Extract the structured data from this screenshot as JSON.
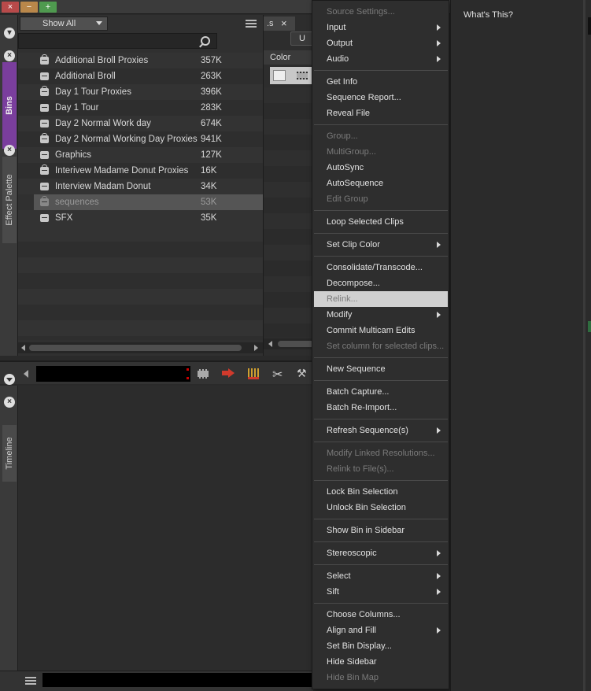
{
  "window": {
    "close": "×",
    "minimize": "−",
    "maximize": "+"
  },
  "bins_panel": {
    "filter": "Show All",
    "tabs": {
      "bins": "Bins",
      "effect_palette": "Effect Palette"
    },
    "items": [
      {
        "name": "Additional Broll Proxies",
        "size": "357K",
        "locked": true
      },
      {
        "name": "Additional Broll",
        "size": "263K",
        "locked": false
      },
      {
        "name": "Day 1 Tour Proxies",
        "size": "396K",
        "locked": true
      },
      {
        "name": "Day 1 Tour",
        "size": "283K",
        "locked": false
      },
      {
        "name": "Day 2 Normal Work day",
        "size": "674K",
        "locked": false
      },
      {
        "name": "Day 2 Normal Working Day Proxies",
        "size": "941K",
        "locked": true
      },
      {
        "name": "Graphics",
        "size": "127K",
        "locked": false
      },
      {
        "name": "Interivew Madame Donut Proxies",
        "size": "16K",
        "locked": true
      },
      {
        "name": "Interview Madam Donut",
        "size": "34K",
        "locked": false
      },
      {
        "name": "sequences",
        "size": "53K",
        "locked": true,
        "selected": true
      },
      {
        "name": "SFX",
        "size": "35K",
        "locked": false
      }
    ]
  },
  "mid_panel": {
    "tab_label": ".s",
    "close": "×",
    "button": "U",
    "column_header": "Color"
  },
  "timeline": {
    "tab": "Timeline"
  },
  "context_menu": {
    "items": [
      {
        "label": "Source Settings...",
        "disabled": true,
        "submenu": false
      },
      {
        "label": "Input",
        "disabled": false,
        "submenu": true
      },
      {
        "label": "Output",
        "disabled": false,
        "submenu": true
      },
      {
        "label": "Audio",
        "disabled": false,
        "submenu": true
      },
      {
        "separator": true
      },
      {
        "label": "Get Info",
        "disabled": false,
        "submenu": false
      },
      {
        "label": "Sequence Report...",
        "disabled": false,
        "submenu": false
      },
      {
        "label": "Reveal File",
        "disabled": false,
        "submenu": false
      },
      {
        "separator": true
      },
      {
        "label": "Group...",
        "disabled": true,
        "submenu": false
      },
      {
        "label": "MultiGroup...",
        "disabled": true,
        "submenu": false
      },
      {
        "label": "AutoSync",
        "disabled": false,
        "submenu": false
      },
      {
        "label": "AutoSequence",
        "disabled": false,
        "submenu": false
      },
      {
        "label": "Edit Group",
        "disabled": true,
        "submenu": false
      },
      {
        "separator": true
      },
      {
        "label": "Loop Selected Clips",
        "disabled": false,
        "submenu": false
      },
      {
        "separator": true
      },
      {
        "label": "Set Clip Color",
        "disabled": false,
        "submenu": true
      },
      {
        "separator": true
      },
      {
        "label": "Consolidate/Transcode...",
        "disabled": false,
        "submenu": false
      },
      {
        "label": "Decompose...",
        "disabled": false,
        "submenu": false
      },
      {
        "label": "Relink...",
        "disabled": false,
        "submenu": false,
        "highlighted": true
      },
      {
        "label": "Modify",
        "disabled": false,
        "submenu": true
      },
      {
        "label": "Commit Multicam Edits",
        "disabled": false,
        "submenu": false
      },
      {
        "label": "Set column for selected clips...",
        "disabled": true,
        "submenu": false
      },
      {
        "separator": true
      },
      {
        "label": "New Sequence",
        "disabled": false,
        "submenu": false
      },
      {
        "separator": true
      },
      {
        "label": "Batch Capture...",
        "disabled": false,
        "submenu": false
      },
      {
        "label": "Batch Re-Import...",
        "disabled": false,
        "submenu": false
      },
      {
        "separator": true
      },
      {
        "label": "Refresh Sequence(s)",
        "disabled": false,
        "submenu": true
      },
      {
        "separator": true
      },
      {
        "label": "Modify Linked Resolutions...",
        "disabled": true,
        "submenu": false
      },
      {
        "label": "Relink to File(s)...",
        "disabled": true,
        "submenu": false
      },
      {
        "separator": true
      },
      {
        "label": "Lock Bin Selection",
        "disabled": false,
        "submenu": false
      },
      {
        "label": "Unlock Bin Selection",
        "disabled": false,
        "submenu": false
      },
      {
        "separator": true
      },
      {
        "label": "Show Bin in Sidebar",
        "disabled": false,
        "submenu": false
      },
      {
        "separator": true
      },
      {
        "label": "Stereoscopic",
        "disabled": false,
        "submenu": true
      },
      {
        "separator": true
      },
      {
        "label": "Select",
        "disabled": false,
        "submenu": true
      },
      {
        "label": "Sift",
        "disabled": false,
        "submenu": true
      },
      {
        "separator": true
      },
      {
        "label": "Choose Columns...",
        "disabled": false,
        "submenu": false
      },
      {
        "label": "Align and Fill",
        "disabled": false,
        "submenu": true
      },
      {
        "label": "Set Bin Display...",
        "disabled": false,
        "submenu": false
      },
      {
        "label": "Hide Sidebar",
        "disabled": false,
        "submenu": false
      },
      {
        "label": "Hide Bin Map",
        "disabled": true,
        "submenu": false
      }
    ]
  },
  "right_panel": {
    "whats_this": "What's This?"
  },
  "colors": {
    "bins_tab": "#7a3e9d",
    "highlight": "#d0d0d0",
    "accent_red": "#d03a2c"
  }
}
